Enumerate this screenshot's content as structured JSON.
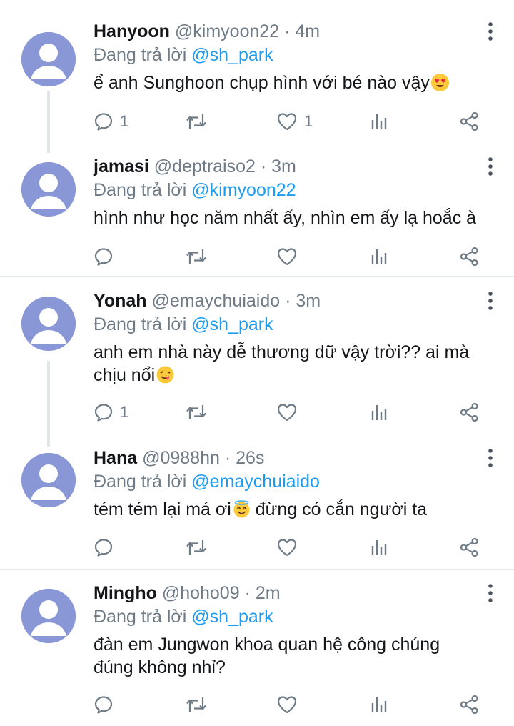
{
  "replying_prefix": "Đang trả lời",
  "tweets": [
    {
      "name": "Hanyoon",
      "handle": "@kimyoon22",
      "time": "4m",
      "reply_to": "@sh_park",
      "text": "ể anh Sunghoon chụp hình với bé nào vậy",
      "emoji": "heart-eyes-emoji",
      "reply_count": "1",
      "like_count": "1"
    },
    {
      "name": "jamasi",
      "handle": "@deptraiso2",
      "time": "3m",
      "reply_to": "@kimyoon22",
      "text": "hình như học năm nhất ấy, nhìn em ấy lạ hoắc à",
      "reply_count": "",
      "like_count": ""
    },
    {
      "name": "Yonah",
      "handle": "@emaychuiaido",
      "time": "3m",
      "reply_to": "@sh_park",
      "text_line1": "anh em nhà này dễ thương dữ vậy trời?? ai mà",
      "text_line2": "chịu nổi",
      "emoji": "tongue-wink-emoji",
      "reply_count": "1",
      "like_count": ""
    },
    {
      "name": "Hana",
      "handle": "@0988hn",
      "time": "26s",
      "reply_to": "@emaychuiaido",
      "text_before": "tém tém lại má ơi",
      "text_after": " đừng có cắn người ta",
      "emoji": "halo-smile-emoji",
      "reply_count": "",
      "like_count": ""
    },
    {
      "name": "Mingho",
      "handle": "@hoho09",
      "time": "2m",
      "reply_to": "@sh_park",
      "text_line1": "đàn em Jungwon khoa quan hệ công chúng",
      "text_line2": "đúng không nhỉ?",
      "reply_count": "",
      "like_count": ""
    }
  ],
  "colors": {
    "accent": "#1d9bf0",
    "muted": "#6e7a85",
    "avatar": "#8a97d6",
    "text": "#141619"
  }
}
